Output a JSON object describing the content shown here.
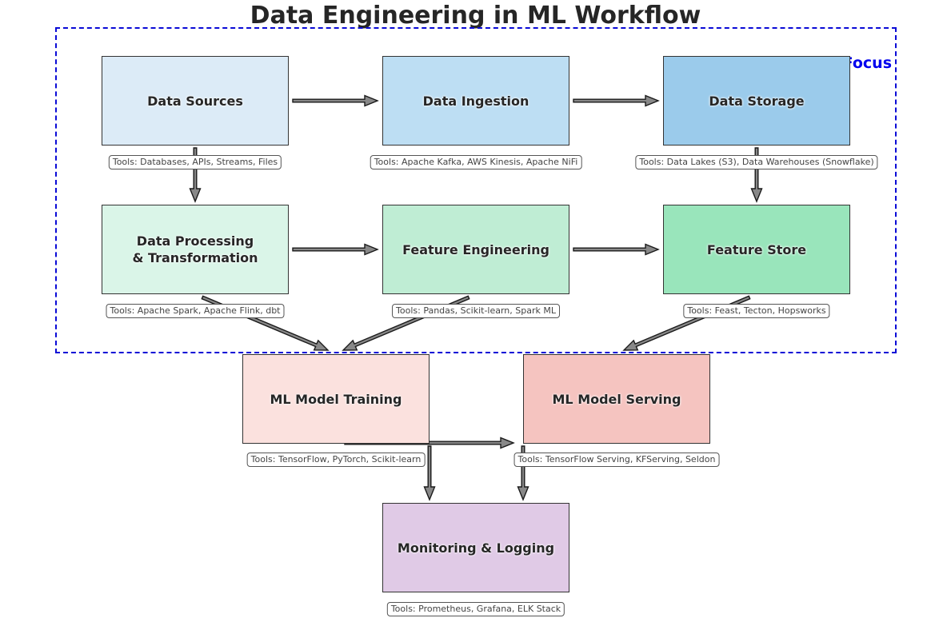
{
  "title": "Data Engineering in ML Workflow",
  "focus_label": "Data Engineering Focus",
  "colors": {
    "focus_border": "#0a0ad6",
    "focus_text": "#0000ee",
    "arrow_fill": "#888888",
    "arrow_stroke": "#1a1a1a"
  },
  "nodes": [
    {
      "id": "data-sources",
      "label": "Data Sources",
      "tools": "Tools: Databases, APIs, Streams, Files",
      "color": "#dcebf7"
    },
    {
      "id": "data-ingestion",
      "label": "Data Ingestion",
      "tools": "Tools: Apache Kafka, AWS Kinesis, Apache NiFi",
      "color": "#bddef3"
    },
    {
      "id": "data-storage",
      "label": "Data Storage",
      "tools": "Tools: Data Lakes (S3), Data Warehouses (Snowflake)",
      "color": "#9bcbeb"
    },
    {
      "id": "data-processing",
      "label": "Data Processing\n& Transformation",
      "tools": "Tools: Apache Spark, Apache Flink, dbt",
      "color": "#daf5e8"
    },
    {
      "id": "feature-engineering",
      "label": "Feature Engineering",
      "tools": "Tools: Pandas, Scikit-learn, Spark ML",
      "color": "#bfedd4"
    },
    {
      "id": "feature-store",
      "label": "Feature Store",
      "tools": "Tools: Feast, Tecton, Hopsworks",
      "color": "#99e5bb"
    },
    {
      "id": "ml-training",
      "label": "ML Model Training",
      "tools": "Tools: TensorFlow, PyTorch, Scikit-learn",
      "color": "#fbe1de"
    },
    {
      "id": "ml-serving",
      "label": "ML Model Serving",
      "tools": "Tools: TensorFlow Serving, KFServing, Seldon",
      "color": "#f5c4c0"
    },
    {
      "id": "monitoring",
      "label": "Monitoring & Logging",
      "tools": "Tools: Prometheus, Grafana, ELK Stack",
      "color": "#e0cae6"
    }
  ],
  "edges": [
    {
      "from": "data-sources",
      "to": "data-ingestion"
    },
    {
      "from": "data-ingestion",
      "to": "data-storage"
    },
    {
      "from": "data-sources",
      "to": "data-processing"
    },
    {
      "from": "data-storage",
      "to": "feature-store"
    },
    {
      "from": "data-processing",
      "to": "feature-engineering"
    },
    {
      "from": "feature-engineering",
      "to": "feature-store"
    },
    {
      "from": "data-processing",
      "to": "ml-training"
    },
    {
      "from": "feature-engineering",
      "to": "ml-training"
    },
    {
      "from": "feature-store",
      "to": "ml-serving"
    },
    {
      "from": "ml-training",
      "to": "ml-serving"
    },
    {
      "from": "ml-training",
      "to": "monitoring"
    },
    {
      "from": "ml-serving",
      "to": "monitoring"
    }
  ]
}
